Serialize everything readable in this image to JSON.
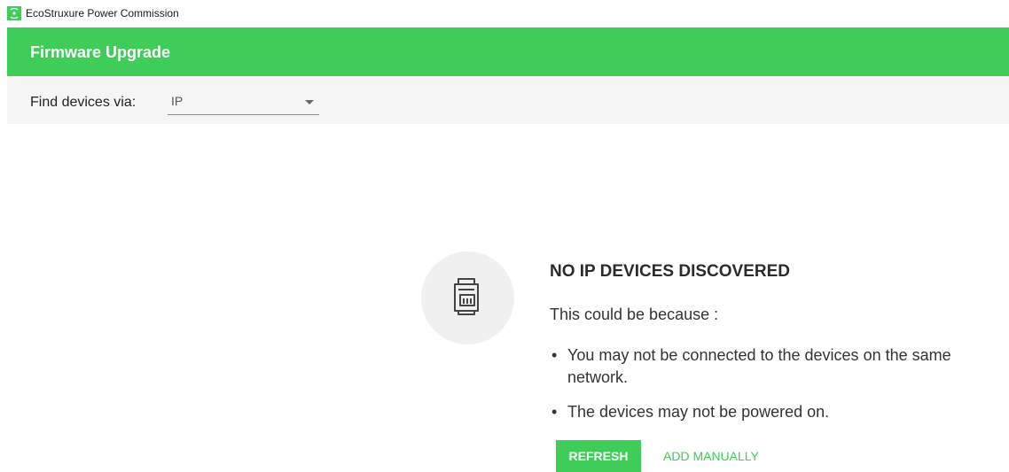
{
  "window": {
    "title": "EcoStruxure Power Commission",
    "logo_icon": "schneider-electric-logo-icon"
  },
  "header": {
    "title": "Firmware Upgrade"
  },
  "filter": {
    "label": "Find devices via:",
    "selected_value": "IP",
    "dropdown_icon": "caret-down-icon"
  },
  "empty_state": {
    "icon": "circuit-breaker-icon",
    "title": "NO IP DEVICES DISCOVERED",
    "subtitle": "This could be because :",
    "reasons": [
      "You may not be connected to the devices on the same network.",
      "The devices may not be powered on."
    ],
    "bullet": "•"
  },
  "actions": {
    "refresh_label": "REFRESH",
    "add_manually_label": "ADD MANUALLY"
  },
  "colors": {
    "brand_green": "#3dcd58",
    "filter_bar_bg": "#f5f5f5",
    "icon_circle_bg": "#f0f0f0"
  }
}
